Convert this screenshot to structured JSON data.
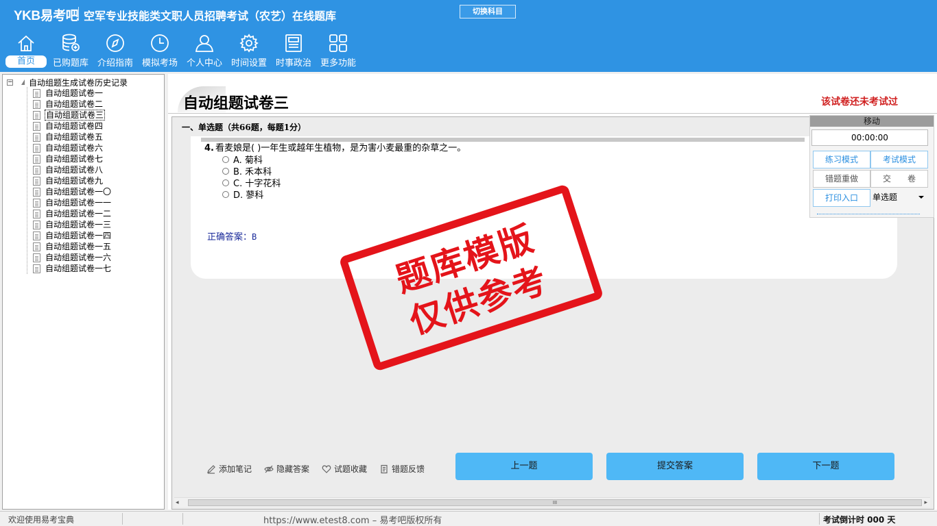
{
  "header": {
    "logo": "YKB易考吧",
    "title": "空军专业技能类文职人员招聘考试（农艺）在线题库",
    "switch_label": "切换科目"
  },
  "nav": [
    {
      "label": "首页",
      "icon": "home-icon"
    },
    {
      "label": "已购题库",
      "icon": "database-icon"
    },
    {
      "label": "介绍指南",
      "icon": "compass-icon"
    },
    {
      "label": "模拟考场",
      "icon": "clock-icon"
    },
    {
      "label": "个人中心",
      "icon": "user-icon"
    },
    {
      "label": "时间设置",
      "icon": "gear-icon"
    },
    {
      "label": "时事政治",
      "icon": "newspaper-icon"
    },
    {
      "label": "更多功能",
      "icon": "grid-icon"
    }
  ],
  "tree": {
    "root": "自动组题生成试卷历史记录",
    "items": [
      "自动组题试卷一",
      "自动组题试卷二",
      "自动组题试卷三",
      "自动组题试卷四",
      "自动组题试卷五",
      "自动组题试卷六",
      "自动组题试卷七",
      "自动组题试卷八",
      "自动组题试卷九",
      "自动组题试卷一〇",
      "自动组题试卷一一",
      "自动组题试卷一二",
      "自动组题试卷一三",
      "自动组题试卷一四",
      "自动组题试卷一五",
      "自动组题试卷一六",
      "自动组题试卷一七"
    ],
    "selected": "自动组题试卷三"
  },
  "main": {
    "paper_title": "自动组题试卷三",
    "status_notice": "该试卷还未考试过",
    "section_title": "一、单选题（共66题，每题1分）",
    "question": {
      "number": "4.",
      "text": "看麦娘是( )一年生或越年生植物，是为害小麦最重的杂草之一。",
      "options": [
        "A. 菊科",
        "B. 禾本科",
        "C. 十字花科",
        "D. 蓼科"
      ],
      "answer_label": "正确答案：",
      "answer": "B"
    },
    "tools": [
      "添加笔记",
      "隐藏答案",
      "试题收藏",
      "错题反馈"
    ],
    "buttons": {
      "prev": "上一题",
      "submit": "提交答案",
      "next": "下一题"
    }
  },
  "float_panel": {
    "header": "移动",
    "timer": "00:00:00",
    "practice_mode": "练习模式",
    "exam_mode": "考试模式",
    "redo_wrong": "错题重做",
    "submit_paper": "交　　卷",
    "print_entry": "打印入口",
    "question_type": "单选题"
  },
  "watermark": {
    "line1": "题库模版",
    "line2": "仅供参考"
  },
  "statusbar": {
    "welcome": "欢迎使用易考宝典",
    "url": "https://www.etest8.com – 易考吧版权所有",
    "countdown": "考试倒计时 000 天"
  },
  "colors": {
    "header_blue": "#2f93e3",
    "button_blue": "#4fb8f6",
    "notice_red": "#d02020",
    "stamp_red": "#e4141a"
  }
}
